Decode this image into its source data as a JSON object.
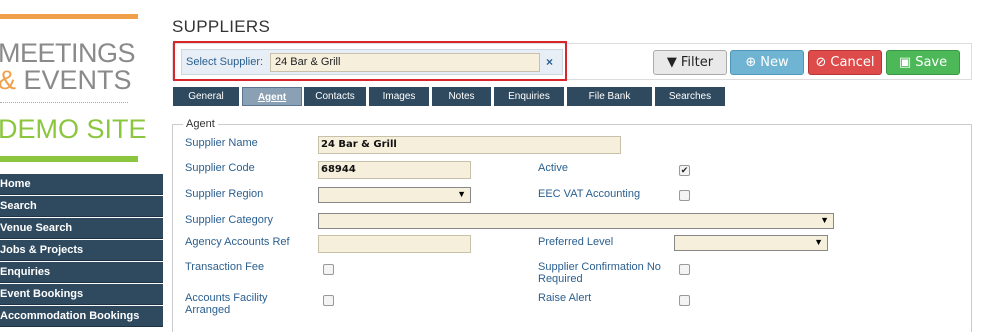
{
  "logo": {
    "line1": "MEETINGS",
    "amp": "&",
    "line2": "EVENTS",
    "demo": "DEMO SITE"
  },
  "nav": {
    "items": [
      "Home",
      "Search",
      "Venue Search",
      "Jobs & Projects",
      "Enquiries",
      "Event Bookings",
      "Accommodation Bookings"
    ]
  },
  "page": {
    "title": "SUPPLIERS"
  },
  "toolbar": {
    "select_label": "Select Supplier:",
    "select_value": "24 Bar & Grill",
    "clear_icon": "×",
    "filter_label": "Filter",
    "new_label": "New",
    "cancel_label": "Cancel",
    "save_label": "Save",
    "colors": {
      "new": "#6fb5d3",
      "cancel": "#dd4b4b",
      "save": "#4db858"
    }
  },
  "tabs": [
    "General",
    "Agent",
    "Contacts",
    "Images",
    "Notes",
    "Enquiries",
    "File Bank",
    "Searches"
  ],
  "active_tab": "Agent",
  "agent": {
    "legend": "Agent",
    "supplier_name_label": "Supplier Name",
    "supplier_name_value": "24 Bar & Grill",
    "supplier_code_label": "Supplier Code",
    "supplier_code_value": "68944",
    "active_label": "Active",
    "active_checked": true,
    "supplier_region_label": "Supplier Region",
    "eec_vat_label": "EEC VAT Accounting",
    "supplier_category_label": "Supplier Category",
    "agency_accounts_ref_label": "Agency Accounts Ref",
    "preferred_level_label": "Preferred Level",
    "transaction_fee_label": "Transaction Fee",
    "supplier_confirmation_label": "Supplier Confirmation No Required",
    "accounts_facility_label": "Accounts Facility Arranged",
    "raise_alert_label": "Raise Alert"
  }
}
